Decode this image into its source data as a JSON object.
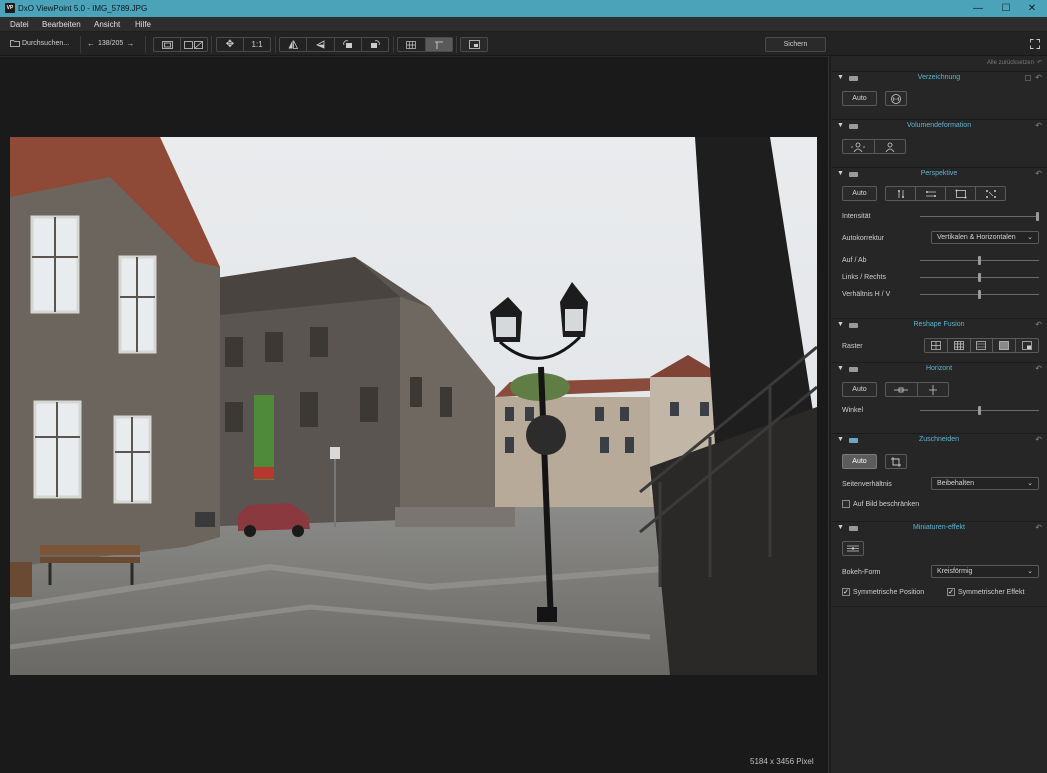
{
  "titlebar": {
    "logo": "VP",
    "title": "DxO ViewPoint 5.0 - IMG_5789.JPG",
    "minimize": "—",
    "maximize": "☐",
    "close": "✕"
  },
  "menu": [
    "Datei",
    "Bearbeiten",
    "Ansicht",
    "Hilfe"
  ],
  "toolbar": {
    "browse_label": "Durchsuchen...",
    "counter": "138/205",
    "zoom_label": "1:1",
    "save_label": "Sichern",
    "icons": [
      "folder-icon",
      "prev-arrow-icon",
      "next-arrow-icon",
      "compare-single-icon",
      "compare-split-icon",
      "move-icon",
      "flip-horizontal-icon",
      "flip-vertical-icon",
      "rotate-left-icon",
      "rotate-right-icon",
      "grid-icon",
      "guides-icon",
      "overlay-icon",
      "fullscreen-icon"
    ]
  },
  "viewer": {
    "pixel_info": "5184 x 3456 Pixel"
  },
  "panel": {
    "reset_all": "Alle zurücksetzen",
    "verzeichnung": {
      "title": "Verzeichnung",
      "auto": "Auto"
    },
    "volumen": {
      "title": "Volumendeformation"
    },
    "perspektive": {
      "title": "Perspektive",
      "auto": "Auto",
      "intensitaet_label": "Intensität",
      "intensitaet_value": 100,
      "autokorrektur_label": "Autokorrektur",
      "autokorrektur_value": "Vertikalen & Horizontalen",
      "aufab_label": "Auf / Ab",
      "aufab_value": 50,
      "linksrechts_label": "Links / Rechts",
      "linksrechts_value": 50,
      "verhaeltnis_label": "Verhältnis H / V",
      "verhaeltnis_value": 50
    },
    "reshape": {
      "title": "Reshape Fusion",
      "raster_label": "Raster"
    },
    "horizont": {
      "title": "Horizont",
      "auto": "Auto",
      "winkel_label": "Winkel",
      "winkel_value": 50
    },
    "zuschneiden": {
      "title": "Zuschneiden",
      "auto": "Auto",
      "seiten_label": "Seitenverhältnis",
      "seiten_value": "Beibehalten",
      "beschraenken_label": "Auf Bild beschränken",
      "beschraenken_checked": false
    },
    "miniatur": {
      "title": "Miniaturen-effekt",
      "bokeh_label": "Bokeh-Form",
      "bokeh_value": "Kreisförmig",
      "sympos_label": "Symmetrische Position",
      "sympos_checked": true,
      "symeff_label": "Symmetrischer Effekt",
      "symeff_checked": true
    }
  },
  "colors": {
    "titlebar": "#4ba3b9",
    "accent_title": "#5db4d2",
    "panel_bg": "#262626"
  }
}
